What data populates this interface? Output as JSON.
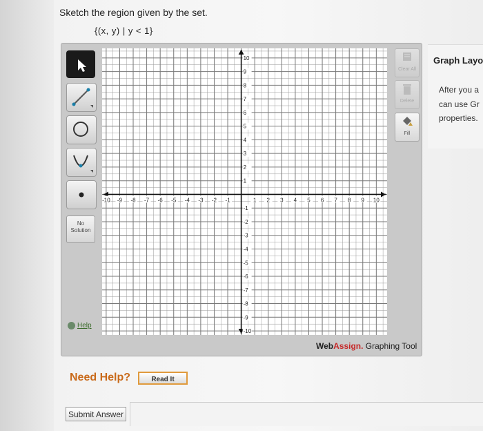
{
  "question": {
    "prompt": "Sketch the region given by the set.",
    "set_notation": "{(x, y) | y < 1}"
  },
  "left_tools": {
    "select": "select-arrow",
    "line": "line",
    "circle": "circle",
    "parabola": "parabola",
    "point": "point",
    "no_solution_line1": "No",
    "no_solution_line2": "Solution",
    "help": "Help"
  },
  "right_tools": {
    "clear_all": "Clear All",
    "delete": "Delete",
    "fill": "Fill"
  },
  "graph": {
    "x_ticks": [
      "-10",
      "-9",
      "-8",
      "-7",
      "-6",
      "-5",
      "-4",
      "-3",
      "-2",
      "-1",
      "1",
      "2",
      "3",
      "4",
      "5",
      "6",
      "7",
      "8",
      "9",
      "10"
    ],
    "y_ticks": [
      "10",
      "9",
      "8",
      "7",
      "6",
      "5",
      "4",
      "3",
      "2",
      "1",
      "-1",
      "-2",
      "-3",
      "-4",
      "-5",
      "-6",
      "-7",
      "-8",
      "-9",
      "-10"
    ],
    "xlim": [
      -10,
      10
    ],
    "ylim": [
      -10,
      10
    ]
  },
  "branding": {
    "web": "Web",
    "assign": "Assign.",
    "tool": " Graphing Tool"
  },
  "side_panel": {
    "title": "Graph Layo",
    "line1": "After you a",
    "line2": "can use Gr",
    "line3": "properties."
  },
  "help_section": {
    "need_help": "Need Help?",
    "read_it": "Read It"
  },
  "submit": {
    "label": "Submit Answer"
  }
}
